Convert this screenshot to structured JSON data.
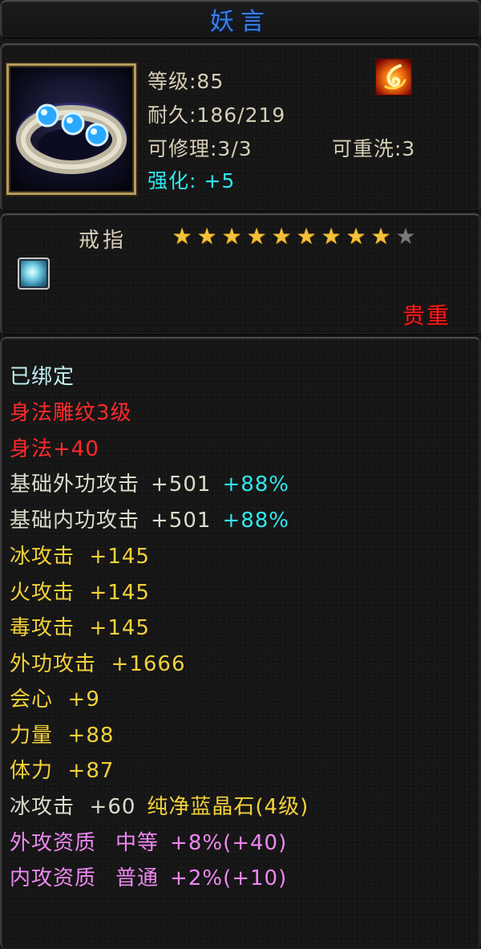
{
  "title": "妖言",
  "info": {
    "level": "等级:85",
    "durability": "耐久:186/219",
    "repair": "可修理:3/3",
    "rewash": "可重洗:3",
    "enhance_label": "强化:",
    "enhance_value": "+5",
    "item_icon": "ring-icon",
    "badge_icon": "fire-badge-icon"
  },
  "mid": {
    "type": "戒指",
    "stars_filled": 9,
    "stars_total": 10,
    "gem_icon": "gem-socket-icon",
    "rarity": "贵重"
  },
  "stats": {
    "bound": "已绑定",
    "engrave": "身法雕纹3级",
    "engrave_bonus": "身法+40",
    "ext_attack_label": "基础外功攻击",
    "ext_attack_value": "+501",
    "ext_attack_pct": "+88%",
    "int_attack_label": "基础内功攻击",
    "int_attack_value": "+501",
    "int_attack_pct": "+88%",
    "ice_attack": "冰攻击  +145",
    "fire_attack": "火攻击  +145",
    "poison_attack": "毒攻击  +145",
    "outer_attack": "外功攻击  +1666",
    "crit": "会心  +9",
    "strength": "力量  +88",
    "stamina": "体力  +87",
    "gem_stat_label": "冰攻击  +60",
    "gem_name": "纯净蓝晶石(4级)",
    "ext_quality_label": "外攻资质",
    "ext_quality_grade": "中等",
    "ext_quality_bonus": "+8%(+40)",
    "int_quality_label": "内攻资质",
    "int_quality_grade": "普通",
    "int_quality_bonus": "+2%(+10)"
  },
  "colors": {
    "title": "#3c7fe6",
    "cyan": "#2fe8ef",
    "red": "#ff2a2a",
    "gold": "#f4d13a",
    "pink": "#ee88f2",
    "star": "#f3c13a"
  }
}
